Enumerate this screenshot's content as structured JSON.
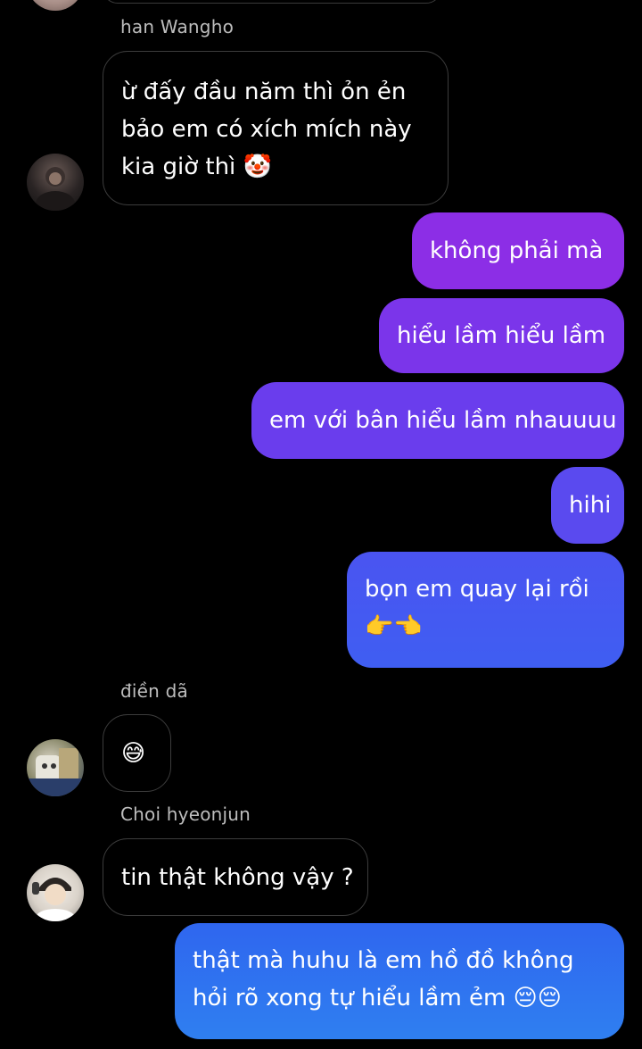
{
  "thread": {
    "names": {
      "first": "han Wangho",
      "second": "điền dã",
      "third": "Choi hyeonjun"
    },
    "messages": {
      "m1": "ừ đấy đầu năm thì ỏn ẻn bảo em có xích mích này kia giờ thì 🤡",
      "m2": "không phải mà",
      "m3": "hiểu lầm hiểu lầm",
      "m4": "em với bân hiểu lầm nhauuuu",
      "m5": "hihi",
      "m6": "bọn em quay lại rồi 👉👈",
      "m7": "😅",
      "m8": "tin thật không vậy ?",
      "m9": "thật mà huhu là em hồ đồ không hỏi rõ xong tự hiểu lầm ẻm 😔😔"
    },
    "icons": {
      "avatar_1": "avatar-photo-icon",
      "avatar_2": "avatar-photo-icon",
      "avatar_3": "avatar-photo-icon"
    },
    "colors": {
      "background": "#000000",
      "incoming_border": "#3c3c3c",
      "outgoing_purple": "#8a2be2",
      "outgoing_blue": "#2f6ff0",
      "sender_name": "#bdbdbd"
    }
  }
}
